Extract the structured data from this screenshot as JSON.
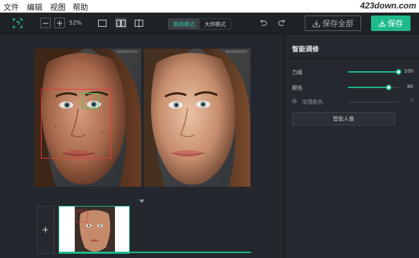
{
  "menu": {
    "items": [
      "文件",
      "编辑",
      "视图",
      "帮助"
    ],
    "watermark": "423down.com"
  },
  "toolbar": {
    "zoom_out": "−",
    "zoom_in": "+",
    "zoom_value": "52%",
    "mode_simple": "精简模式",
    "mode_master": "大师模式",
    "save_all": "保存全部",
    "save": "保存"
  },
  "canvas": {
    "photo_caption": "HUSAIN KUTLU"
  },
  "filmstrip": {
    "add_label": "+"
  },
  "panel": {
    "title": "智能调修",
    "strength_label": "力度",
    "strength_value": "100",
    "strength_level": 1.0,
    "color_label": "颜色",
    "color_value": "80",
    "color_level": 0.8,
    "enhance_label": "加强肤色",
    "enhance_value": "0",
    "smart_button": "智能人像"
  },
  "colors": {
    "accent": "#1fb98e",
    "face_box": "#e03b3b",
    "eye_box": "#3fd04a"
  }
}
